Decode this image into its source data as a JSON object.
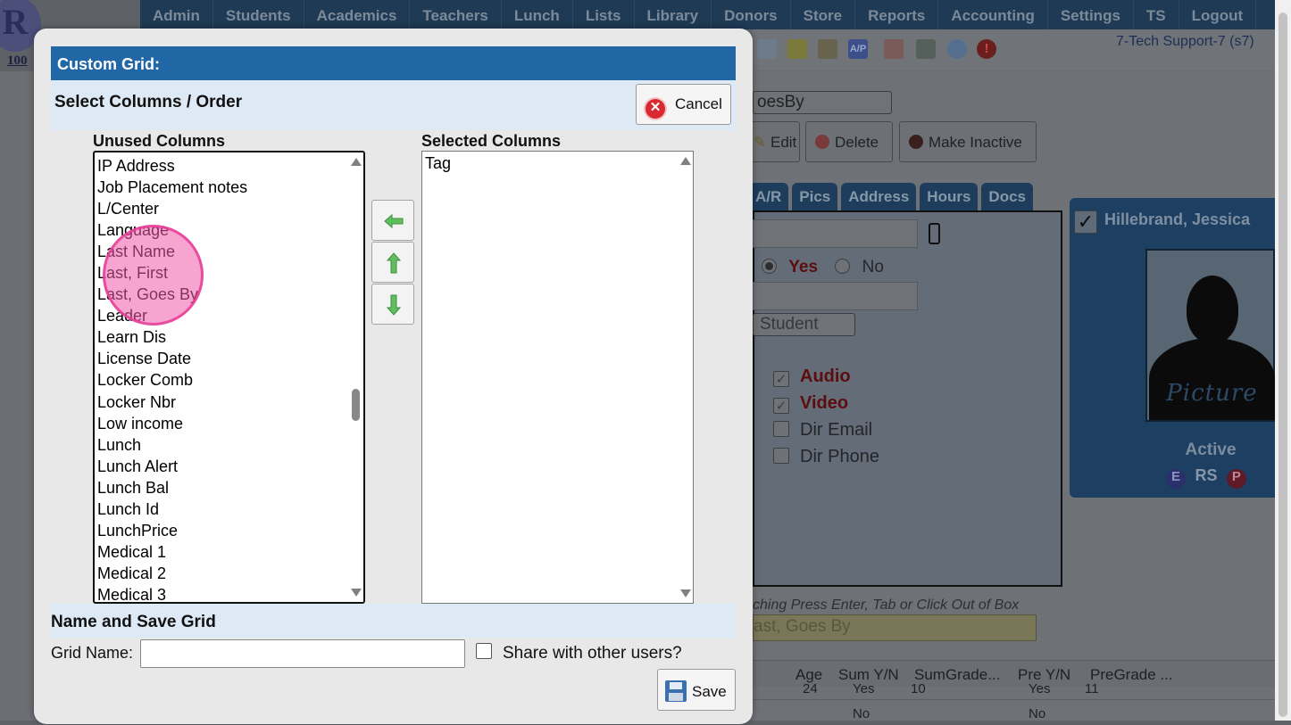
{
  "background_app": {
    "logo_number": "100",
    "nav_items": [
      "Admin",
      "Students",
      "Academics",
      "Teachers",
      "Lunch",
      "Lists",
      "Library",
      "Donors",
      "Store",
      "Reports",
      "Accounting",
      "Settings",
      "TS",
      "Logout"
    ],
    "tech_support_label": "7-Tech Support-7 (s7)",
    "sort_select_value": "oesBy",
    "buttons": {
      "edit": "Edit",
      "delete": "Delete",
      "make_inactive": "Make Inactive"
    },
    "tabs": [
      "A/R",
      "Pics",
      "Address",
      "Hours",
      "Docs"
    ],
    "yes_label": "Yes",
    "no_label": "No",
    "type_select_value": "Student",
    "checkboxes": [
      {
        "label": "Audio",
        "checked": true,
        "style": "bold-red"
      },
      {
        "label": "Video",
        "checked": true,
        "style": "bold-red"
      },
      {
        "label": "Dir Email",
        "checked": false,
        "style": "normal"
      },
      {
        "label": "Dir Phone",
        "checked": false,
        "style": "normal"
      }
    ],
    "student_card": {
      "name": "Hillebrand, Jessica",
      "photo_caption": "Picture",
      "status": "Active",
      "badges": [
        "E",
        "RS",
        "P"
      ]
    },
    "hint_text": "ching Press Enter, Tab or Click Out of Box",
    "search_value": "ast, Goes By",
    "table": {
      "headers": [
        "Age",
        "Sum Y/N",
        "SumGrade...",
        "Pre Y/N",
        "PreGrade ..."
      ],
      "row1": [
        "24",
        "Yes",
        "10",
        "Yes",
        "11"
      ],
      "row2": [
        "",
        "No",
        "",
        "No",
        ""
      ]
    }
  },
  "dialog": {
    "title": "Custom Grid:",
    "select_section_title": "Select Columns / Order",
    "cancel_label": "Cancel",
    "unused_label": "Unused Columns",
    "selected_label": "Selected Columns",
    "unused_columns": [
      "IP Address",
      "Job Placement notes",
      "L/Center",
      "Language",
      "Last Name",
      "Last, First",
      "Last, Goes By",
      "Leader",
      "Learn Dis",
      "License Date",
      "Locker Comb",
      "Locker Nbr",
      "Low income",
      "Lunch",
      "Lunch Alert",
      "Lunch Bal",
      "Lunch Id",
      "LunchPrice",
      "Medical 1",
      "Medical 2",
      "Medical 3"
    ],
    "selected_columns": [
      "Tag"
    ],
    "unused_scroll_position": 0.57,
    "save_section_title": "Name and Save Grid",
    "grid_name_label": "Grid Name:",
    "grid_name_value": "",
    "share_label": "Share with other users?",
    "share_checked": false,
    "save_label": "Save"
  },
  "colors": {
    "header_blue": "#2167a6",
    "section_bg": "#dde9f5",
    "accent_red": "#d9282f",
    "arrow_green": "#5fbf5f",
    "click_marker": "#f05aaa"
  }
}
